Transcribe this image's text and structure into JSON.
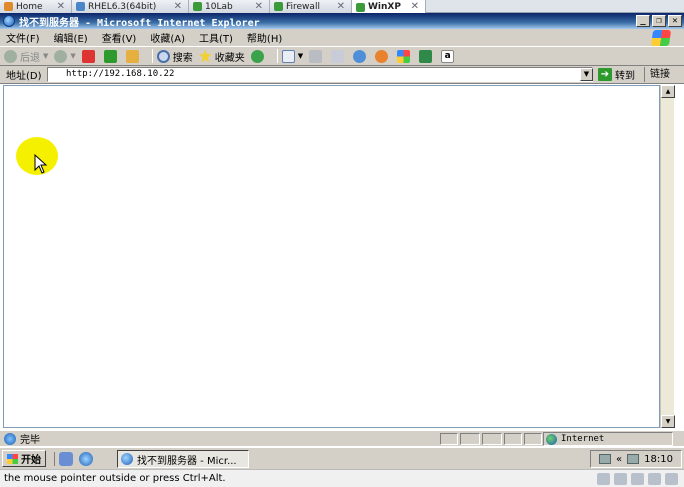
{
  "vm_tabs": [
    {
      "label": "Home",
      "color": "#e08a2e"
    },
    {
      "label": "RHEL6.3(64bit)",
      "color": "#4a86c8"
    },
    {
      "label": "10Lab",
      "color": "#3b9b3b"
    },
    {
      "label": "Firewall",
      "color": "#3b9b3b"
    },
    {
      "label": "WinXP",
      "color": "#3b9b3b"
    }
  ],
  "window": {
    "title": "找不到服务器 - Microsoft Internet Explorer"
  },
  "menu": [
    "文件(F)",
    "编辑(E)",
    "查看(V)",
    "收藏(A)",
    "工具(T)",
    "帮助(H)"
  ],
  "toolbar": {
    "back": "后退",
    "search": "搜索",
    "favorites": "收藏夹"
  },
  "address": {
    "label": "地址(D)",
    "value": "http://192.168.10.22",
    "go": "转到",
    "links": "链接"
  },
  "status": {
    "text": "完毕",
    "zone": "Internet"
  },
  "taskbar": {
    "start": "开始",
    "task": "找不到服务器 - Micr...",
    "clock": "18:10"
  },
  "vm_status": "the mouse pointer outside or press Ctrl+Alt."
}
